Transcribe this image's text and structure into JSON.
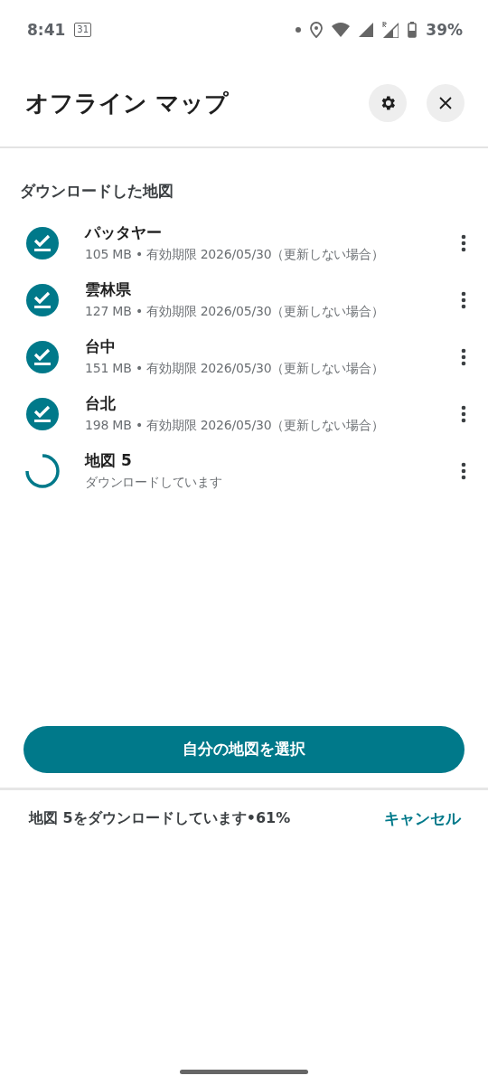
{
  "status_bar": {
    "time": "8:41",
    "calendar_day": "31",
    "battery": "39%"
  },
  "header": {
    "title": "オフライン マップ"
  },
  "section_title": "ダウンロードした地図",
  "maps": [
    {
      "kind": "done",
      "name": "パッタヤー",
      "detail": "105 MB • 有効期限 2026/05/30（更新しない場合）"
    },
    {
      "kind": "done",
      "name": "雲林県",
      "detail": "127 MB • 有効期限 2026/05/30（更新しない場合）"
    },
    {
      "kind": "done",
      "name": "台中",
      "detail": "151 MB • 有効期限 2026/05/30（更新しない場合）"
    },
    {
      "kind": "done",
      "name": "台北",
      "detail": "198 MB • 有効期限 2026/05/30（更新しない場合）"
    },
    {
      "kind": "downloading",
      "name": "地図 5",
      "detail": "ダウンロードしています"
    }
  ],
  "select_button": "自分の地図を選択",
  "download_bar": {
    "message": "地図 5をダウンロードしています•61%",
    "action": "キャンセル"
  }
}
